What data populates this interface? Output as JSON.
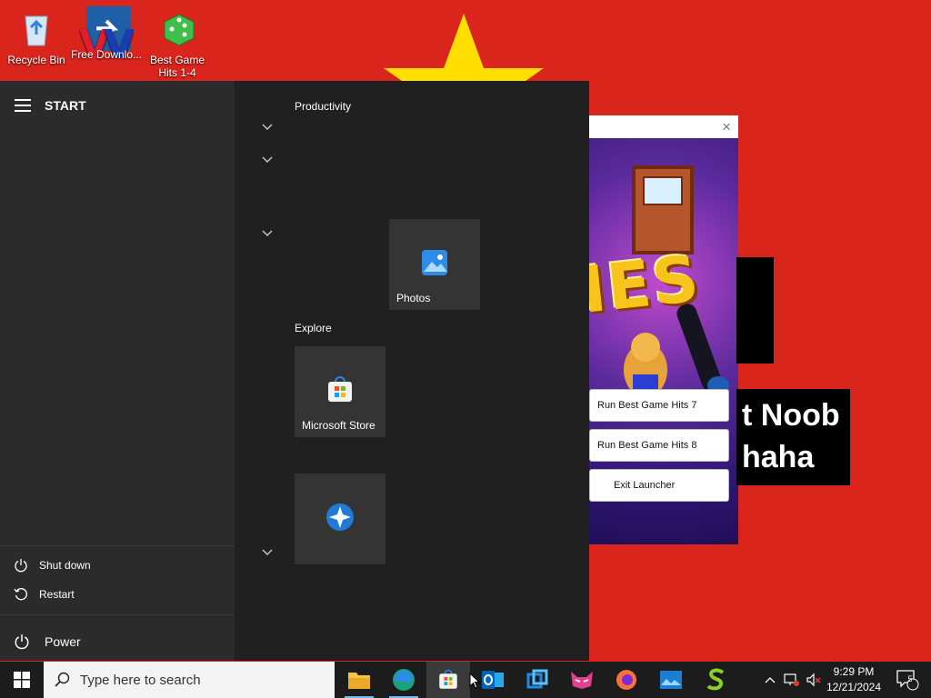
{
  "desktop": {
    "icons": [
      {
        "name": "recycle-bin",
        "label": "Recycle Bin"
      },
      {
        "name": "free-download",
        "label": "Free Downlo..."
      },
      {
        "name": "best-game-hits",
        "label": "Best Game Hits 1-4"
      }
    ],
    "black_text_lines": [
      "t Noob",
      "haha"
    ]
  },
  "launcher": {
    "close": "×",
    "art_text": "IES",
    "buttons": [
      "Run Best Game Hits 7",
      "Run Best Game Hits 8",
      "Exit Launcher"
    ]
  },
  "start_menu": {
    "title": "START",
    "groups": [
      "Productivity",
      "Explore"
    ],
    "tiles": [
      {
        "name": "photos",
        "label": "Photos"
      },
      {
        "name": "microsoft-store",
        "label": "Microsoft Store"
      },
      {
        "name": "unknown-app",
        "label": ""
      }
    ],
    "power_options": [
      "Shut down",
      "Restart"
    ],
    "power_label": "Power"
  },
  "taskbar": {
    "search_placeholder": "Type here to search",
    "apps": [
      "file-explorer",
      "edge",
      "microsoft-store",
      "outlook",
      "virtualbox",
      "app-pink",
      "firefox",
      "app-blue",
      "app-s"
    ],
    "time": "9:29 PM",
    "date": "12/21/2024",
    "notification_count": "5"
  },
  "colors": {
    "wallpaper": "#da251d",
    "star": "#ffde00",
    "accent": "#76b9ed"
  }
}
